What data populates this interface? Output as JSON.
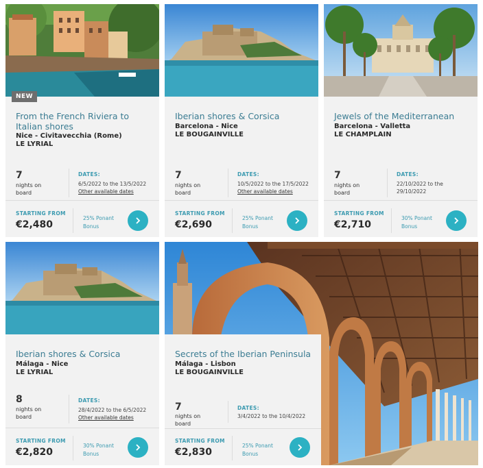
{
  "cards": [
    {
      "badge": "NEW",
      "title": "From the French Riviera to Italian shores",
      "route": "Nice - Civitavecchia (Rome)",
      "ship": "LE LYRIAL",
      "nights": "7",
      "nights_label": "nights on board",
      "dates_label": "DATES:",
      "dates": "6/5/2022 to the 13/5/2022",
      "other_dates": "Other available dates",
      "starting_label": "STARTING FROM",
      "price": "€2,480",
      "bonus": "25% Ponant Bonus"
    },
    {
      "title": "Iberian shores & Corsica",
      "route": "Barcelona - Nice",
      "ship": "LE BOUGAINVILLE",
      "nights": "7",
      "nights_label": "nights on board",
      "dates_label": "DATES:",
      "dates": "10/5/2022 to the 17/5/2022",
      "other_dates": "Other available dates",
      "starting_label": "STARTING FROM",
      "price": "€2,690",
      "bonus": "25% Ponant Bonus"
    },
    {
      "title": "Jewels of the Mediterranean",
      "route": "Barcelona - Valletta",
      "ship": "LE CHAMPLAIN",
      "nights": "7",
      "nights_label": "nights on board",
      "dates_label": "DATES:",
      "dates": "22/10/2022 to the 29/10/2022",
      "starting_label": "STARTING FROM",
      "price": "€2,710",
      "bonus": "30% Ponant Bonus"
    },
    {
      "title": "Iberian shores & Corsica",
      "route": "Málaga - Nice",
      "ship": "LE LYRIAL",
      "nights": "8",
      "nights_label": "nights on board",
      "dates_label": "DATES:",
      "dates": "28/4/2022 to the 6/5/2022",
      "other_dates": "Other available dates",
      "starting_label": "STARTING FROM",
      "price": "€2,820",
      "bonus": "30% Ponant Bonus"
    },
    {
      "title": "Secrets of the Iberian Peninsula",
      "route": "Málaga - Lisbon",
      "ship": "LE BOUGAINVILLE",
      "nights": "7",
      "nights_label": "nights on board",
      "dates_label": "DATES:",
      "dates": "3/4/2022 to the 10/4/2022",
      "starting_label": "STARTING FROM",
      "price": "€2,830",
      "bonus": "25% Ponant Bonus"
    }
  ],
  "colors": {
    "title": "#3b7c92",
    "accent": "#2cb1c3",
    "card_bg": "#f2f2f2"
  },
  "icons": {
    "go_button": "chevron-right-icon"
  }
}
